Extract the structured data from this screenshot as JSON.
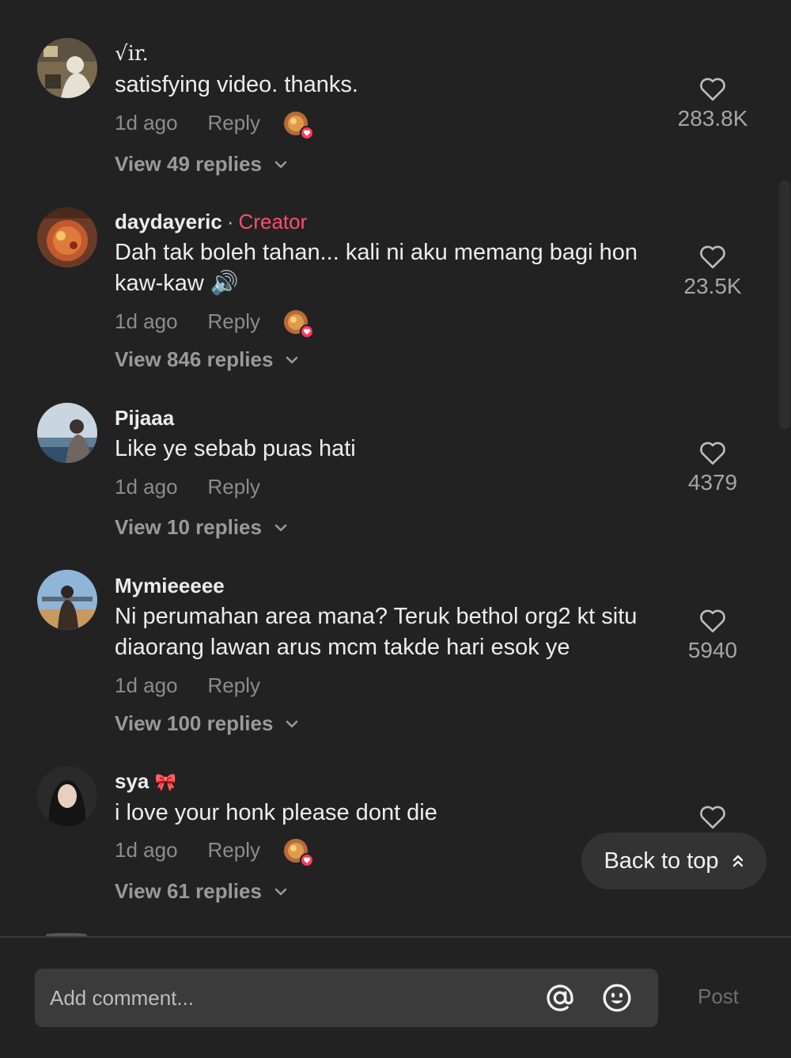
{
  "comments": [
    {
      "username": "√",
      "username_suffix": "ir.",
      "text": "satisfying video. thanks.",
      "time": "1d ago",
      "reply_label": "Reply",
      "creator_liked": true,
      "view_replies": "View 49 replies",
      "likes": "283.8K"
    },
    {
      "username": "daydayeric",
      "badge_separator": "·",
      "badge": "Creator",
      "text": "Dah tak boleh tahan... kali ni aku memang bagi hon kaw-kaw 🔊",
      "time": "1d ago",
      "reply_label": "Reply",
      "creator_liked": true,
      "view_replies": "View 846 replies",
      "likes": "23.5K"
    },
    {
      "username": "Pijaaa",
      "text": "Like ye sebab puas hati",
      "time": "1d ago",
      "reply_label": "Reply",
      "creator_liked": false,
      "view_replies": "View 10 replies",
      "likes": "4379"
    },
    {
      "username": "Mymieeeee",
      "text": "Ni perumahan area mana? Teruk bethol org2 kt situ diaorang lawan arus mcm takde hari esok ye",
      "time": "1d ago",
      "reply_label": "Reply",
      "creator_liked": false,
      "view_replies": "View 100 replies",
      "likes": "5940"
    },
    {
      "username": "sya",
      "username_suffix": "🎀",
      "text": "i love your honk please dont die",
      "time": "1d ago",
      "reply_label": "Reply",
      "creator_liked": true,
      "view_replies": "View 61 replies",
      "likes": ""
    }
  ],
  "back_to_top": "Back to top",
  "composer": {
    "placeholder": "Add comment...",
    "post_label": "Post"
  },
  "colors": {
    "background": "#222222",
    "creator_badge": "#ff4d6d",
    "like_heart_badge": "#ff3b5c"
  },
  "icons": [
    "heart-icon",
    "chevron-down-icon",
    "chevrons-up-icon",
    "at-sign-icon",
    "emoji-icon"
  ]
}
